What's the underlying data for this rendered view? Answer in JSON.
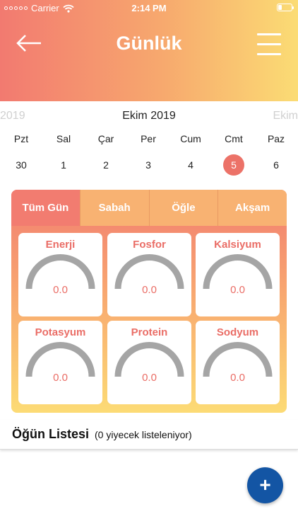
{
  "status_bar": {
    "carrier": "Carrier",
    "time": "2:14 PM"
  },
  "header": {
    "title": "Günlük",
    "back_icon": "arrow-left-icon",
    "menu_icon": "hamburger-menu-icon"
  },
  "calendar": {
    "prev_month": "2019",
    "current_month": "Ekim 2019",
    "next_month": "Ekim",
    "days": [
      {
        "name": "Pzt",
        "number": "30"
      },
      {
        "name": "Sal",
        "number": "1"
      },
      {
        "name": "Çar",
        "number": "2"
      },
      {
        "name": "Per",
        "number": "3"
      },
      {
        "name": "Cum",
        "number": "4"
      },
      {
        "name": "Cmt",
        "number": "5",
        "selected": true
      },
      {
        "name": "Paz",
        "number": "6"
      }
    ]
  },
  "tabs": [
    {
      "label": "Tüm Gün",
      "active": true
    },
    {
      "label": "Sabah"
    },
    {
      "label": "Öğle"
    },
    {
      "label": "Akşam"
    }
  ],
  "nutrients": [
    {
      "name": "Enerji",
      "value": "0.0"
    },
    {
      "name": "Fosfor",
      "value": "0.0"
    },
    {
      "name": "Kalsiyum",
      "value": "0.0"
    },
    {
      "name": "Potasyum",
      "value": "0.0"
    },
    {
      "name": "Protein",
      "value": "0.0"
    },
    {
      "name": "Sodyum",
      "value": "0.0"
    }
  ],
  "meal_list": {
    "title": "Öğün Listesi",
    "subtitle": "(0 yiyecek listeleniyor)"
  },
  "fab": {
    "label": "+"
  },
  "colors": {
    "accent": "#ec7268",
    "gauge": "#a5a5a5",
    "fab": "#1355a4"
  }
}
